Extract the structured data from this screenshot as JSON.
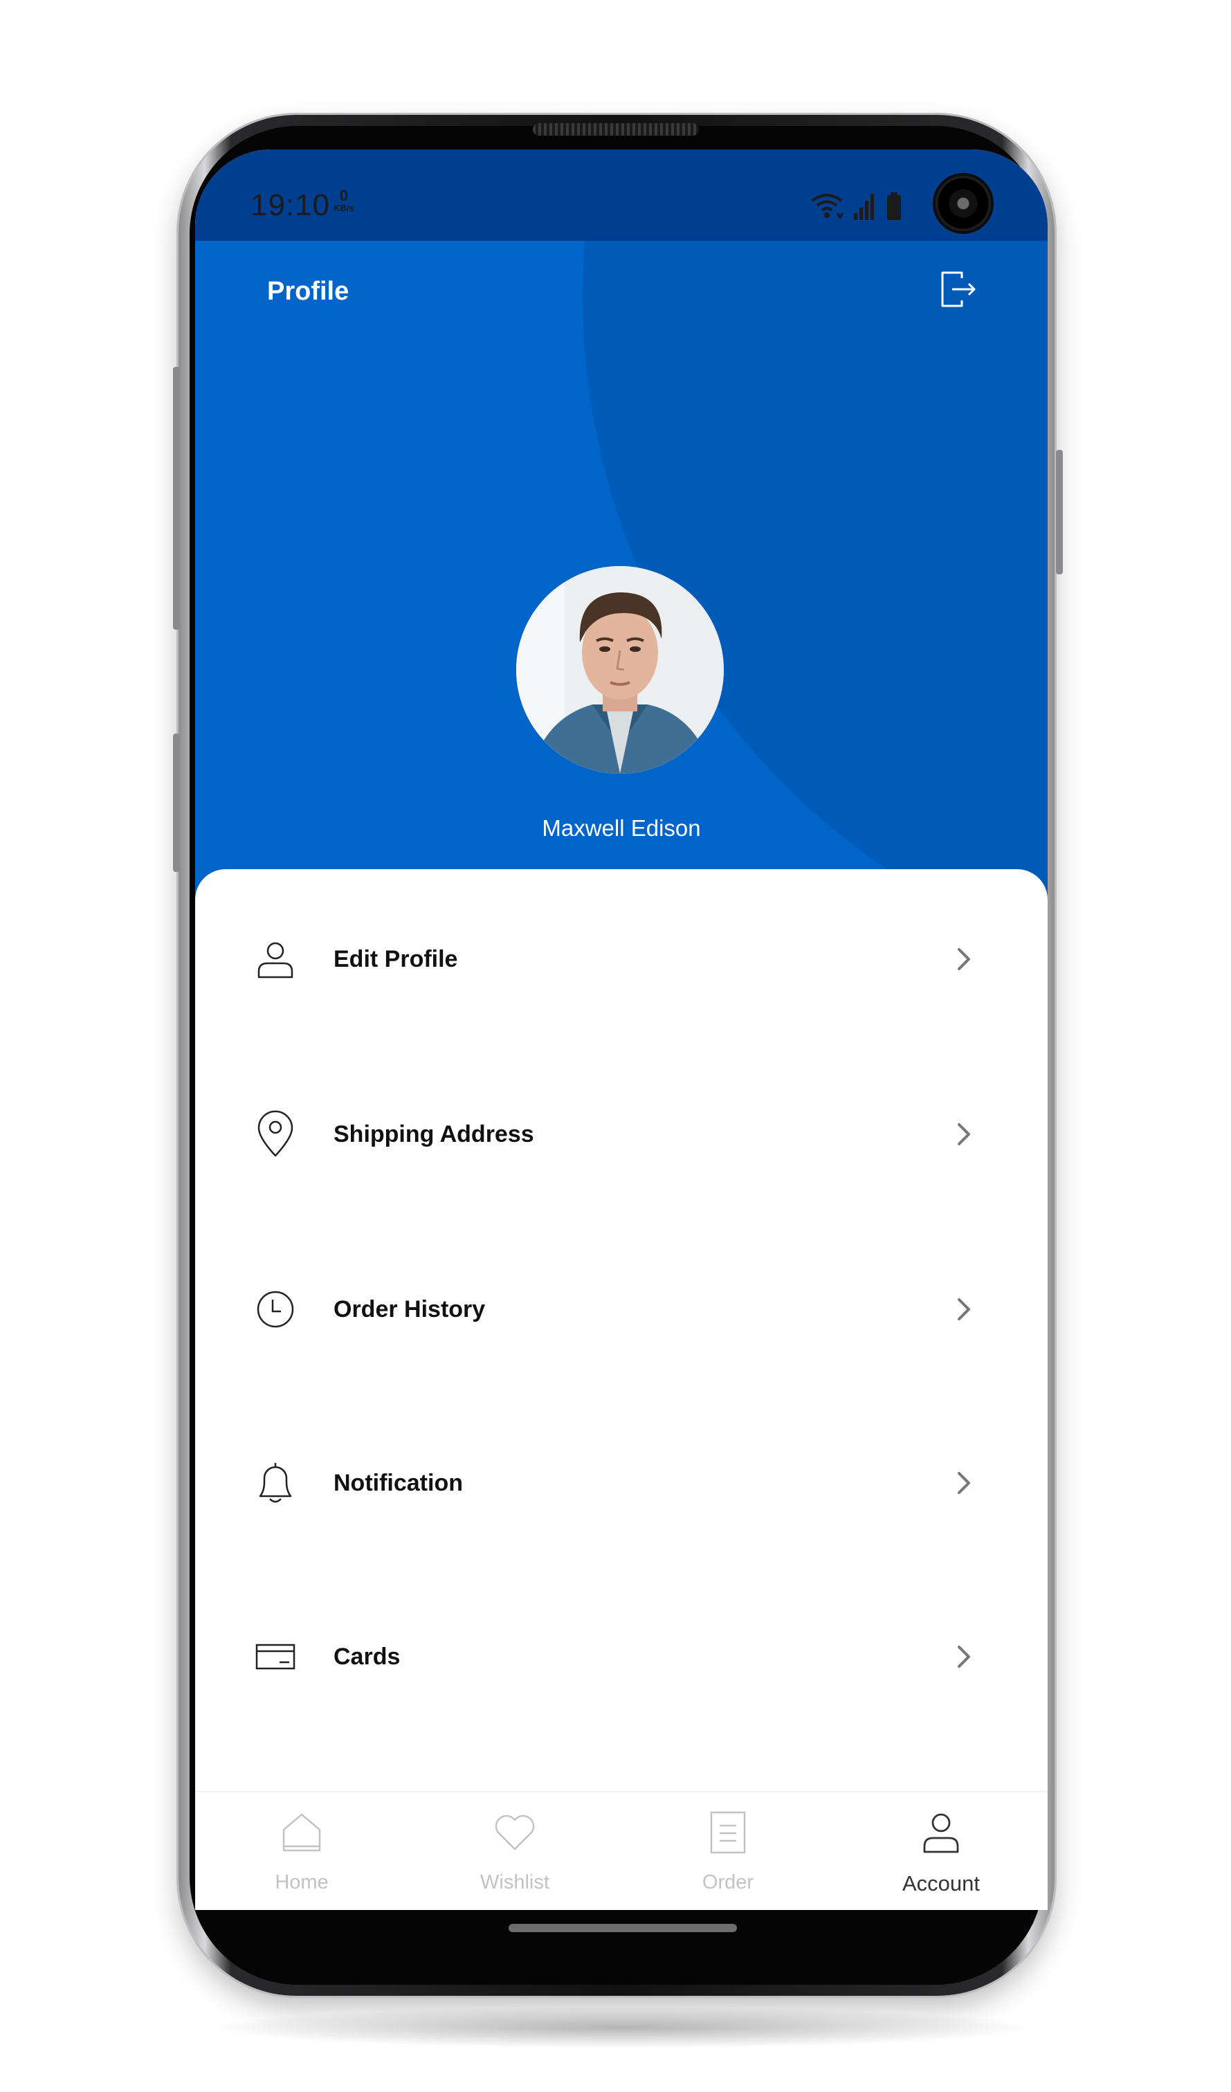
{
  "status_bar": {
    "time": "19:10",
    "net_speed_value": "0",
    "net_speed_unit": "KB/s",
    "icons": [
      "wifi-icon",
      "signal-icon",
      "battery-icon"
    ]
  },
  "header": {
    "title": "Profile",
    "logout_icon": "logout-icon",
    "user_name": "Maxwell Edison"
  },
  "menu": {
    "items": [
      {
        "label": "Edit Profile",
        "icon": "user-icon"
      },
      {
        "label": "Shipping Address",
        "icon": "location-pin-icon"
      },
      {
        "label": "Order History",
        "icon": "clock-icon"
      },
      {
        "label": "Notification",
        "icon": "bell-icon"
      },
      {
        "label": "Cards",
        "icon": "credit-card-icon"
      }
    ]
  },
  "bottom_nav": {
    "items": [
      {
        "label": "Home",
        "icon": "home-icon",
        "active": false
      },
      {
        "label": "Wishlist",
        "icon": "heart-icon",
        "active": false
      },
      {
        "label": "Order",
        "icon": "order-list-icon",
        "active": false
      },
      {
        "label": "Account",
        "icon": "user-icon",
        "active": true
      }
    ]
  },
  "colors": {
    "primary": "#0064c8",
    "primary_dark": "#005bb8",
    "status_bar": "#003f8f",
    "text_dark": "#111111",
    "nav_inactive": "#c3c3c3",
    "nav_active": "#333333"
  }
}
